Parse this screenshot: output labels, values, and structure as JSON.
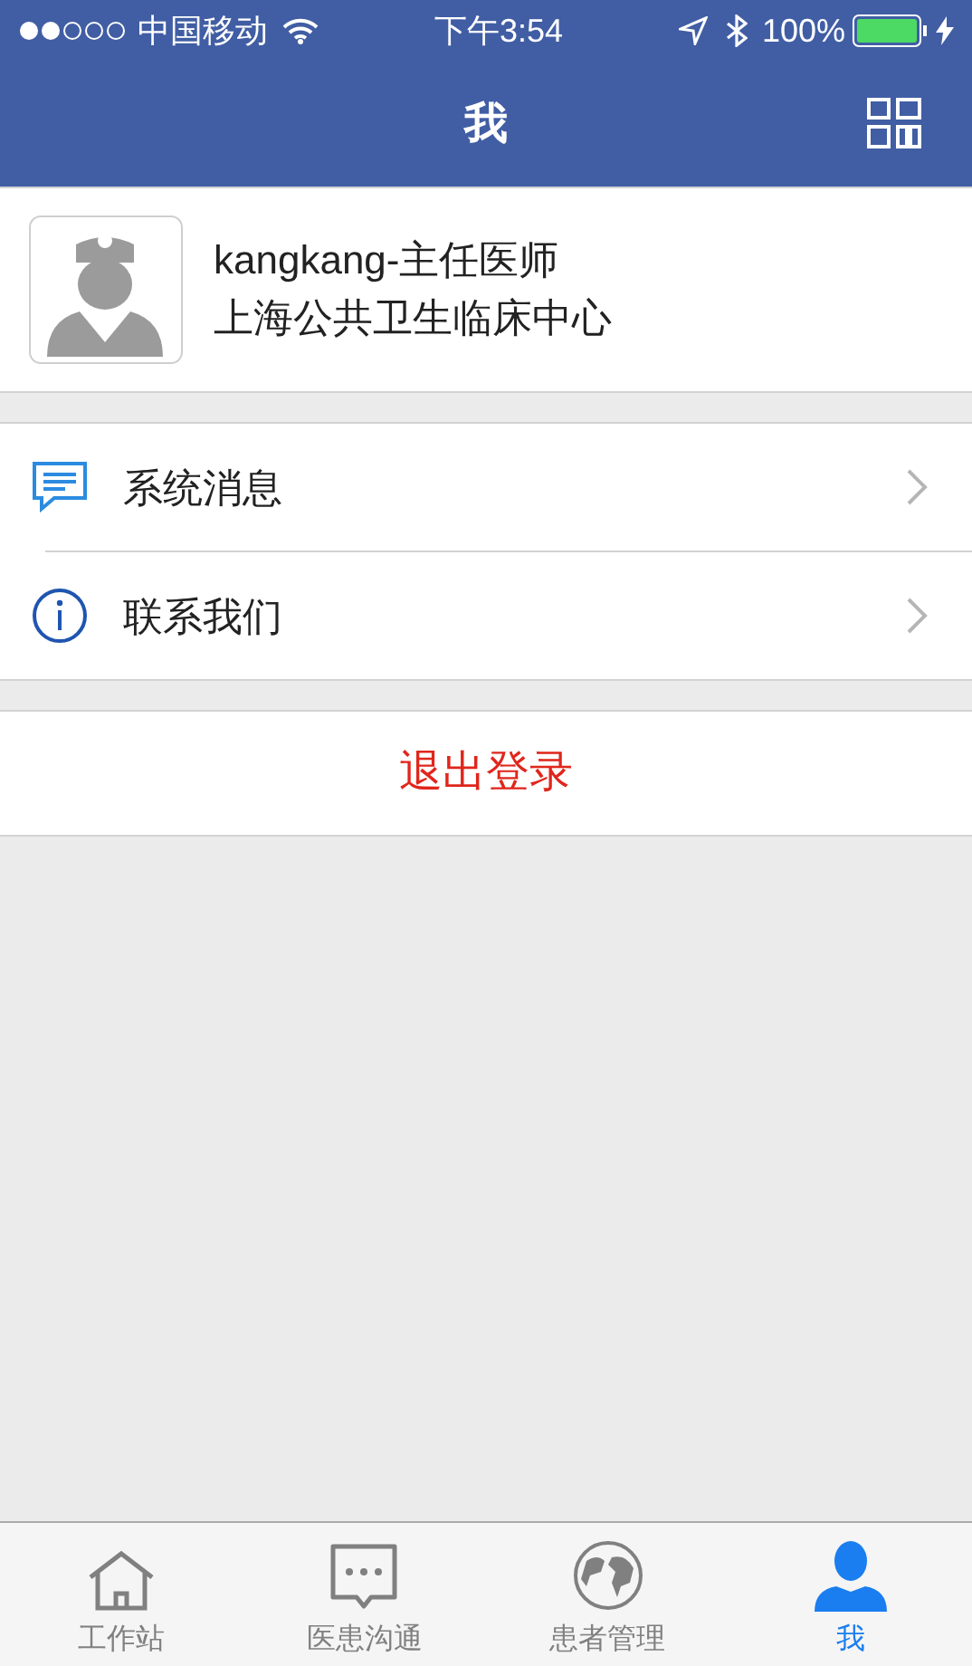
{
  "status_bar": {
    "carrier": "中国移动",
    "time": "下午3:54",
    "battery": "100%"
  },
  "nav_bar": {
    "title": "我"
  },
  "profile": {
    "name": "kangkang-主任医师",
    "organization": "上海公共卫生临床中心"
  },
  "menu": [
    {
      "kind": "message",
      "label": "系统消息"
    },
    {
      "kind": "info",
      "label": "联系我们"
    }
  ],
  "logout": {
    "label": "退出登录"
  },
  "tab_bar": [
    {
      "kind": "home",
      "label": "工作站",
      "selected": false
    },
    {
      "kind": "chat",
      "label": "医患沟通",
      "selected": false
    },
    {
      "kind": "globe",
      "label": "患者管理",
      "selected": false
    },
    {
      "kind": "person",
      "label": "我",
      "selected": true
    }
  ]
}
